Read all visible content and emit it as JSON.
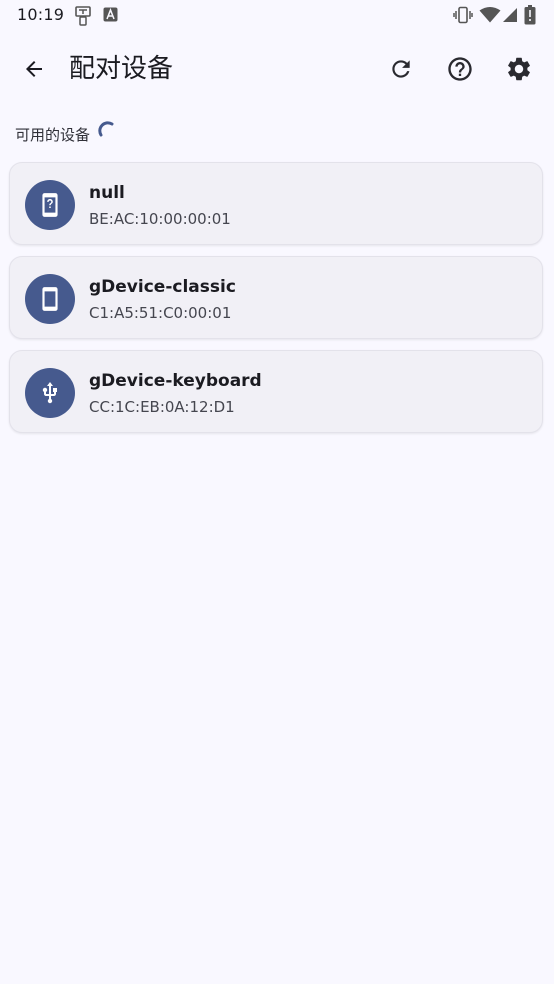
{
  "status_bar": {
    "time": "10:19"
  },
  "app_bar": {
    "title": "配对设备"
  },
  "section": {
    "label": "可用的设备"
  },
  "devices": [
    {
      "name": "null",
      "address": "BE:AC:10:00:00:01",
      "icon": "unknown-phone-icon"
    },
    {
      "name": "gDevice-classic",
      "address": "C1:A5:51:C0:00:01",
      "icon": "smartphone-icon"
    },
    {
      "name": "gDevice-keyboard",
      "address": "CC:1C:EB:0A:12:D1",
      "icon": "usb-icon"
    }
  ],
  "colors": {
    "background": "#f9f8ff",
    "card": "#f1f0f6",
    "accent": "#465a8e",
    "text_primary": "#1b1b21",
    "text_secondary": "#45464f"
  }
}
